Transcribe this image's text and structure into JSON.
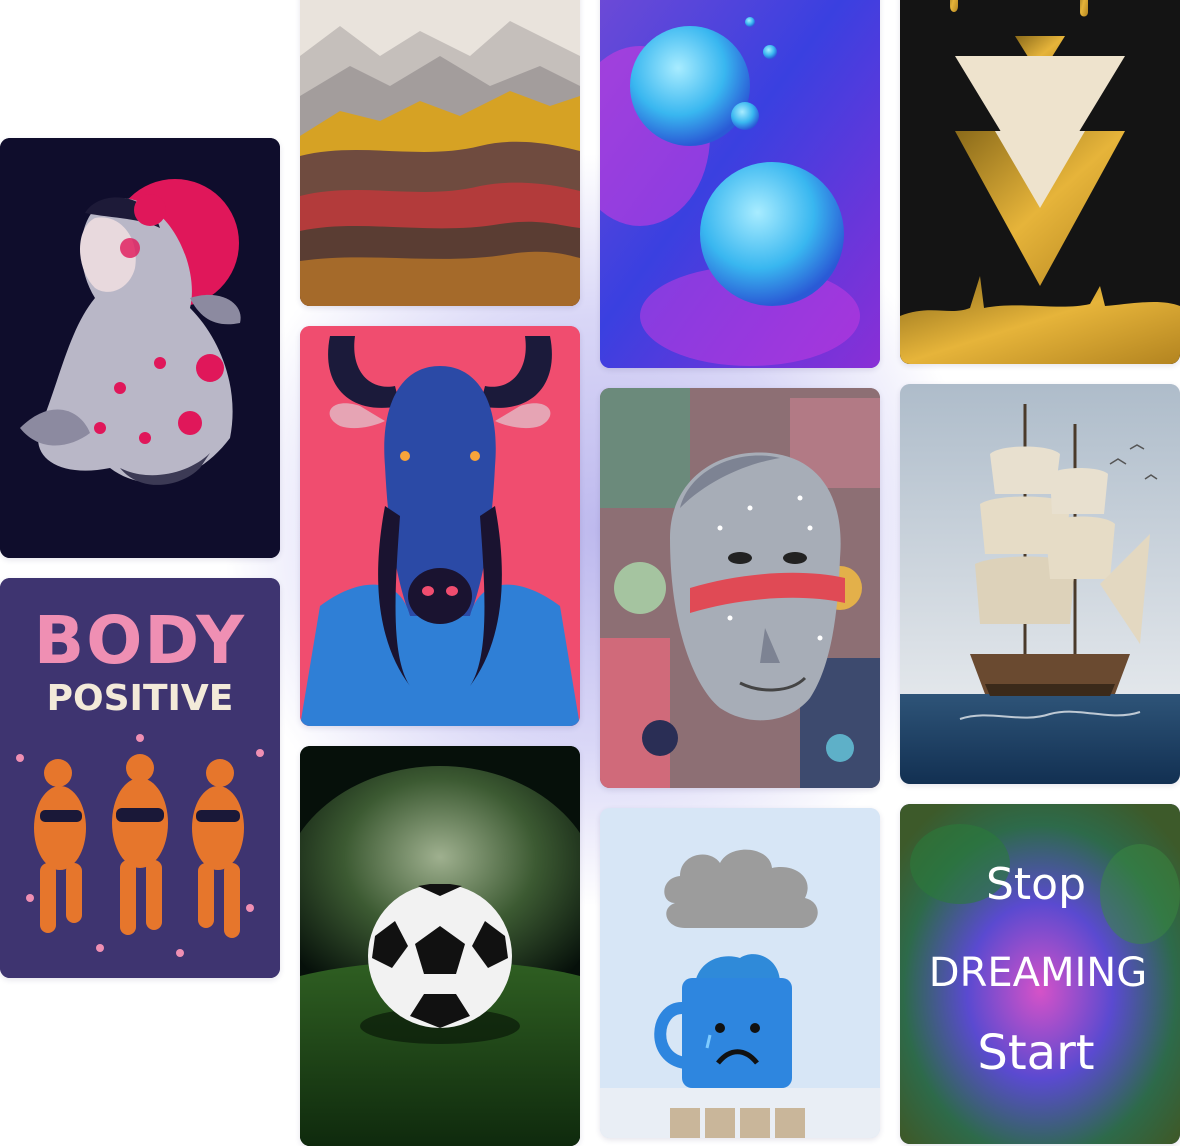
{
  "posters": [
    {
      "id": "geisha",
      "icon": "geisha-illustration"
    },
    {
      "id": "body-positive",
      "icon": "dancing-women-illustration",
      "title": "BODY",
      "subtitle": "POSITIVE"
    },
    {
      "id": "golden-mountains",
      "icon": "mountain-landscape"
    },
    {
      "id": "wildebeest",
      "icon": "bull-portrait"
    },
    {
      "id": "soccer-ball",
      "icon": "soccer-ball-photo"
    },
    {
      "id": "spheres",
      "icon": "floating-spheres-3d"
    },
    {
      "id": "cyber-head",
      "icon": "statue-head-collage"
    },
    {
      "id": "sad-mug",
      "icon": "rain-cloud-mug"
    },
    {
      "id": "gold-triangles",
      "icon": "gold-triangles-abstract"
    },
    {
      "id": "sailing-ship",
      "icon": "tall-ship-painting"
    },
    {
      "id": "stop-dreaming",
      "icon": "motivational-quote",
      "lines": [
        "Stop",
        "DREAMING",
        "Start"
      ]
    }
  ],
  "colors": {
    "background": "#ffffff",
    "glow": "#a8a2e8",
    "body_pink": "#ef8fb3",
    "body_orange": "#e6762c",
    "text_cream": "#f3ead9"
  }
}
